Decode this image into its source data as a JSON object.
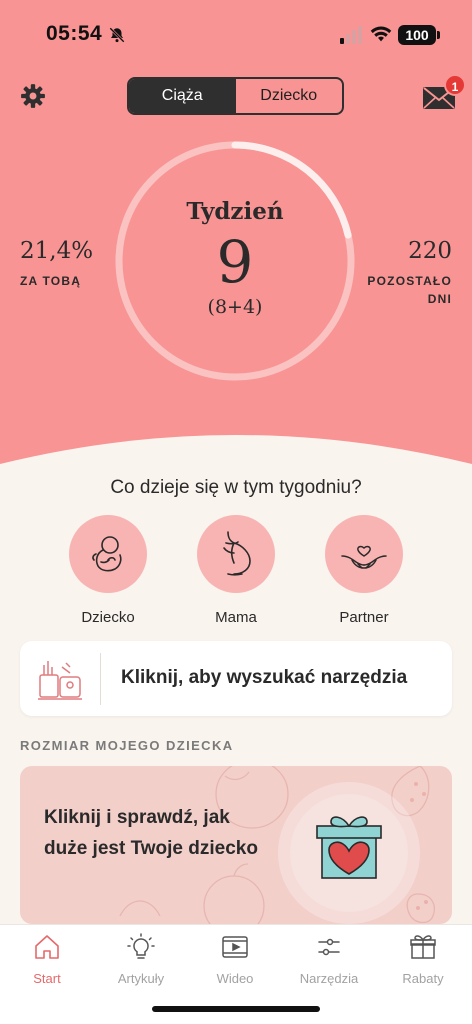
{
  "status": {
    "time": "05:54",
    "battery": "100"
  },
  "header": {
    "tabs": [
      {
        "label": "Ciąża",
        "active": true
      },
      {
        "label": "Dziecko",
        "active": false
      }
    ],
    "mail_badge": "1"
  },
  "progress": {
    "week_label": "Tydzień",
    "week_number": "9",
    "week_detail": "(8+4)",
    "done_fraction": 0.214,
    "left_value": "21,4%",
    "left_label": "ZA TOBĄ",
    "right_value": "220",
    "right_label_line1": "POZOSTAŁO",
    "right_label_line2": "DNI"
  },
  "this_week": {
    "question": "Co dzieje się w tym tygodniu?",
    "items": [
      {
        "label": "Dziecko",
        "icon": "fetus-icon"
      },
      {
        "label": "Mama",
        "icon": "pregnant-belly-icon"
      },
      {
        "label": "Partner",
        "icon": "hands-heart-icon"
      }
    ]
  },
  "tools_card": {
    "text": "Kliknij, aby wyszukać narzędzia",
    "icon": "tools-icon"
  },
  "size_section": {
    "heading": "ROZMIAR MOJEGO DZIECKA",
    "card_text": "Kliknij i sprawdź, jak duże jest Twoje dziecko",
    "icon": "gift-heart-icon"
  },
  "tabbar": {
    "items": [
      {
        "label": "Start",
        "icon": "home-icon",
        "active": true
      },
      {
        "label": "Artykuły",
        "icon": "lightbulb-icon",
        "active": false
      },
      {
        "label": "Wideo",
        "icon": "video-icon",
        "active": false
      },
      {
        "label": "Narzędzia",
        "icon": "tools-icon",
        "active": false
      },
      {
        "label": "Rabaty",
        "icon": "gift-icon",
        "active": false
      }
    ]
  },
  "colors": {
    "hero": "#f99494",
    "background": "#faf4ef",
    "ring_track": "#fbc2c2",
    "ring_progress": "#fdeeee",
    "category_circle": "#f8b4b2",
    "active_tab": "#e5696b",
    "badge": "#e53935"
  }
}
